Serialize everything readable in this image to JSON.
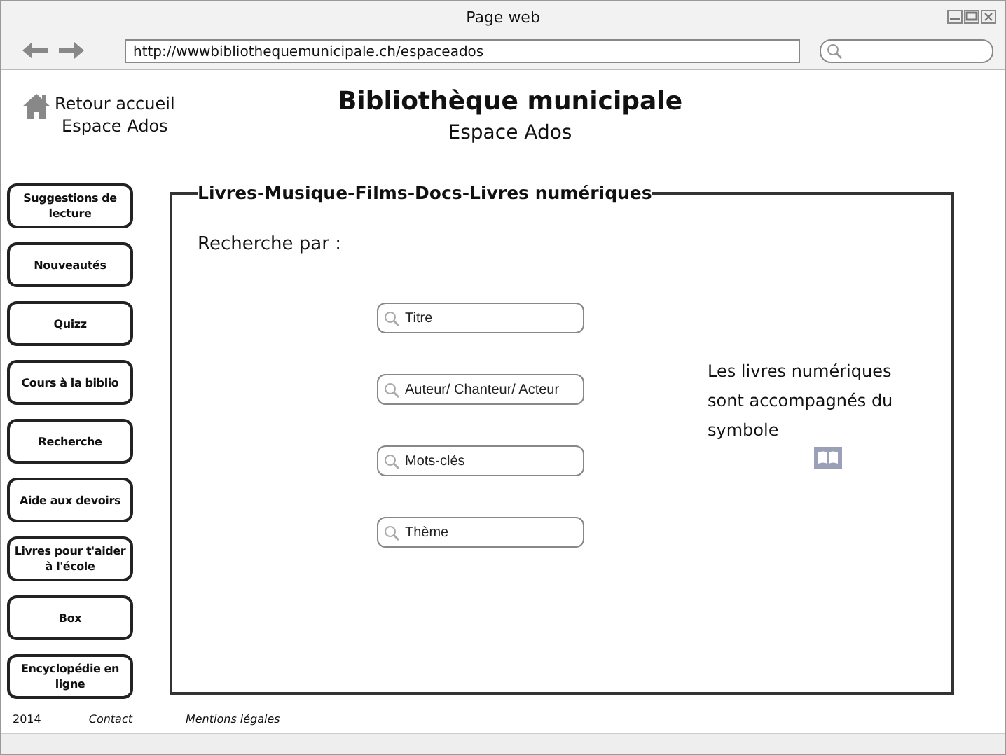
{
  "window": {
    "title": "Page web"
  },
  "browser": {
    "address": "http://wwwbibliothequemunicipale.ch/espaceados"
  },
  "header": {
    "home_link": [
      "Retour accueil",
      "Espace Ados"
    ],
    "title": "Bibliothèque municipale",
    "subtitle": "Espace Ados"
  },
  "sidebar": {
    "items": [
      {
        "label": "Suggestions de lecture"
      },
      {
        "label": "Nouveautés"
      },
      {
        "label": "Quizz"
      },
      {
        "label": "Cours à la biblio"
      },
      {
        "label": "Recherche"
      },
      {
        "label": "Aide aux devoirs"
      },
      {
        "label": "Livres pour t'aider à l'école"
      },
      {
        "label": "Box"
      },
      {
        "label": "Encyclopédie en ligne"
      }
    ]
  },
  "main": {
    "legend": "Livres-Musique-Films-Docs-Livres numériques",
    "heading": "Recherche par :",
    "search_fields": [
      {
        "placeholder": "Titre"
      },
      {
        "placeholder": "Auteur/ Chanteur/ Acteur"
      },
      {
        "placeholder": "Mots-clés"
      },
      {
        "placeholder": "Thème"
      }
    ],
    "note": "Les livres numériques sont accompagnés du symbole"
  },
  "footer": [
    "2014",
    "Contact",
    "Mentions légales"
  ]
}
